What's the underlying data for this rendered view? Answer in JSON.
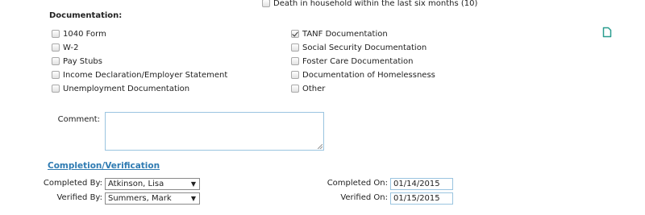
{
  "household": {
    "death_label": "Death in household within the last six months (10)",
    "death_checked": false
  },
  "documentation": {
    "title": "Documentation:",
    "left_items": [
      {
        "label": "1040 Form",
        "checked": false
      },
      {
        "label": "W-2",
        "checked": false
      },
      {
        "label": "Pay Stubs",
        "checked": false
      },
      {
        "label": "Income Declaration/Employer Statement",
        "checked": false
      },
      {
        "label": "Unemployment Documentation",
        "checked": false
      }
    ],
    "right_items": [
      {
        "label": "TANF Documentation",
        "checked": true
      },
      {
        "label": "Social Security Documentation",
        "checked": false
      },
      {
        "label": "Foster Care Documentation",
        "checked": false
      },
      {
        "label": "Documentation of Homelessness",
        "checked": false
      },
      {
        "label": "Other",
        "checked": false
      }
    ],
    "icon": "document-icon"
  },
  "comment": {
    "label": "Comment:",
    "value": ""
  },
  "completion": {
    "title": "Completion/Verification",
    "completed_by_label": "Completed By:",
    "completed_by_value": "Atkinson, Lisa",
    "verified_by_label": "Verified By:",
    "verified_by_value": "Summers, Mark",
    "completed_on_label": "Completed On:",
    "completed_on_value": "01/14/2015",
    "verified_on_label": "Verified On:",
    "verified_on_value": "01/15/2015"
  },
  "colors": {
    "link": "#2f7bb2",
    "input_border": "#9ac4e0",
    "icon": "#2a9d8f"
  }
}
